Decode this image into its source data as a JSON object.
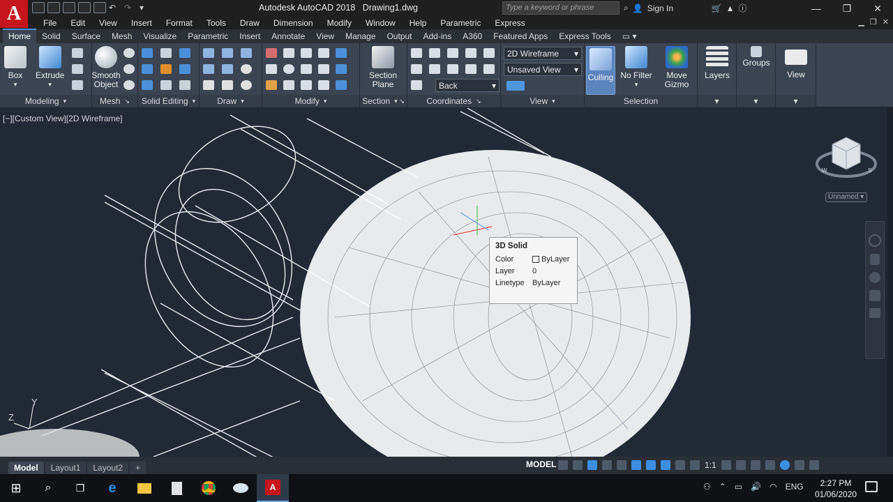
{
  "app": {
    "title": "Autodesk AutoCAD 2018",
    "file": "Drawing1.dwg",
    "logo": "A",
    "search_placeholder": "Type a keyword or phrase",
    "sign_in": "Sign In"
  },
  "menu": [
    "File",
    "Edit",
    "View",
    "Insert",
    "Format",
    "Tools",
    "Draw",
    "Dimension",
    "Modify",
    "Window",
    "Help",
    "Parametric",
    "Express"
  ],
  "ribbon_tabs": [
    "Home",
    "Solid",
    "Surface",
    "Mesh",
    "Visualize",
    "Parametric",
    "Insert",
    "Annotate",
    "View",
    "Manage",
    "Output",
    "Add-ins",
    "A360",
    "Featured Apps",
    "Express Tools"
  ],
  "ribbon": {
    "box": "Box",
    "extrude": "Extrude",
    "smooth_1": "Smooth",
    "smooth_2": "Object",
    "section_1": "Section",
    "section_2": "Plane",
    "visual_style": "2D Wireframe",
    "view_name": "Unsaved View",
    "back": "Back",
    "culling": "Culling",
    "no_filter": "No Filter",
    "move_1": "Move",
    "move_2": "Gizmo",
    "layers": "Layers",
    "groups": "Groups",
    "view": "View",
    "panels": {
      "modeling": "Modeling",
      "mesh": "Mesh",
      "solid_editing": "Solid Editing",
      "draw": "Draw",
      "modify": "Modify",
      "section": "Section",
      "coordinates": "Coordinates",
      "view": "View",
      "selection": "Selection"
    }
  },
  "viewport": {
    "label": "[−][Custom View][2D Wireframe]",
    "unnamed": "Unnamed",
    "ucs_y": "Y",
    "ucs_z": "Z"
  },
  "tooltip": {
    "title": "3D Solid",
    "rows": [
      {
        "key": "Color",
        "value": "ByLayer"
      },
      {
        "key": "Layer",
        "value": "0"
      },
      {
        "key": "Linetype",
        "value": "ByLayer"
      }
    ]
  },
  "layout_tabs": [
    "Model",
    "Layout1",
    "Layout2"
  ],
  "status": {
    "model": "MODEL",
    "scale": "1:1"
  },
  "taskbar": {
    "lang": "ENG",
    "time": "2:27 PM",
    "date": "01/06/2020"
  },
  "colors": {
    "viewport_bg": "#212836",
    "ribbon_bg": "#3b4453",
    "accent": "#4a90d9",
    "logo_red": "#c4161c"
  }
}
